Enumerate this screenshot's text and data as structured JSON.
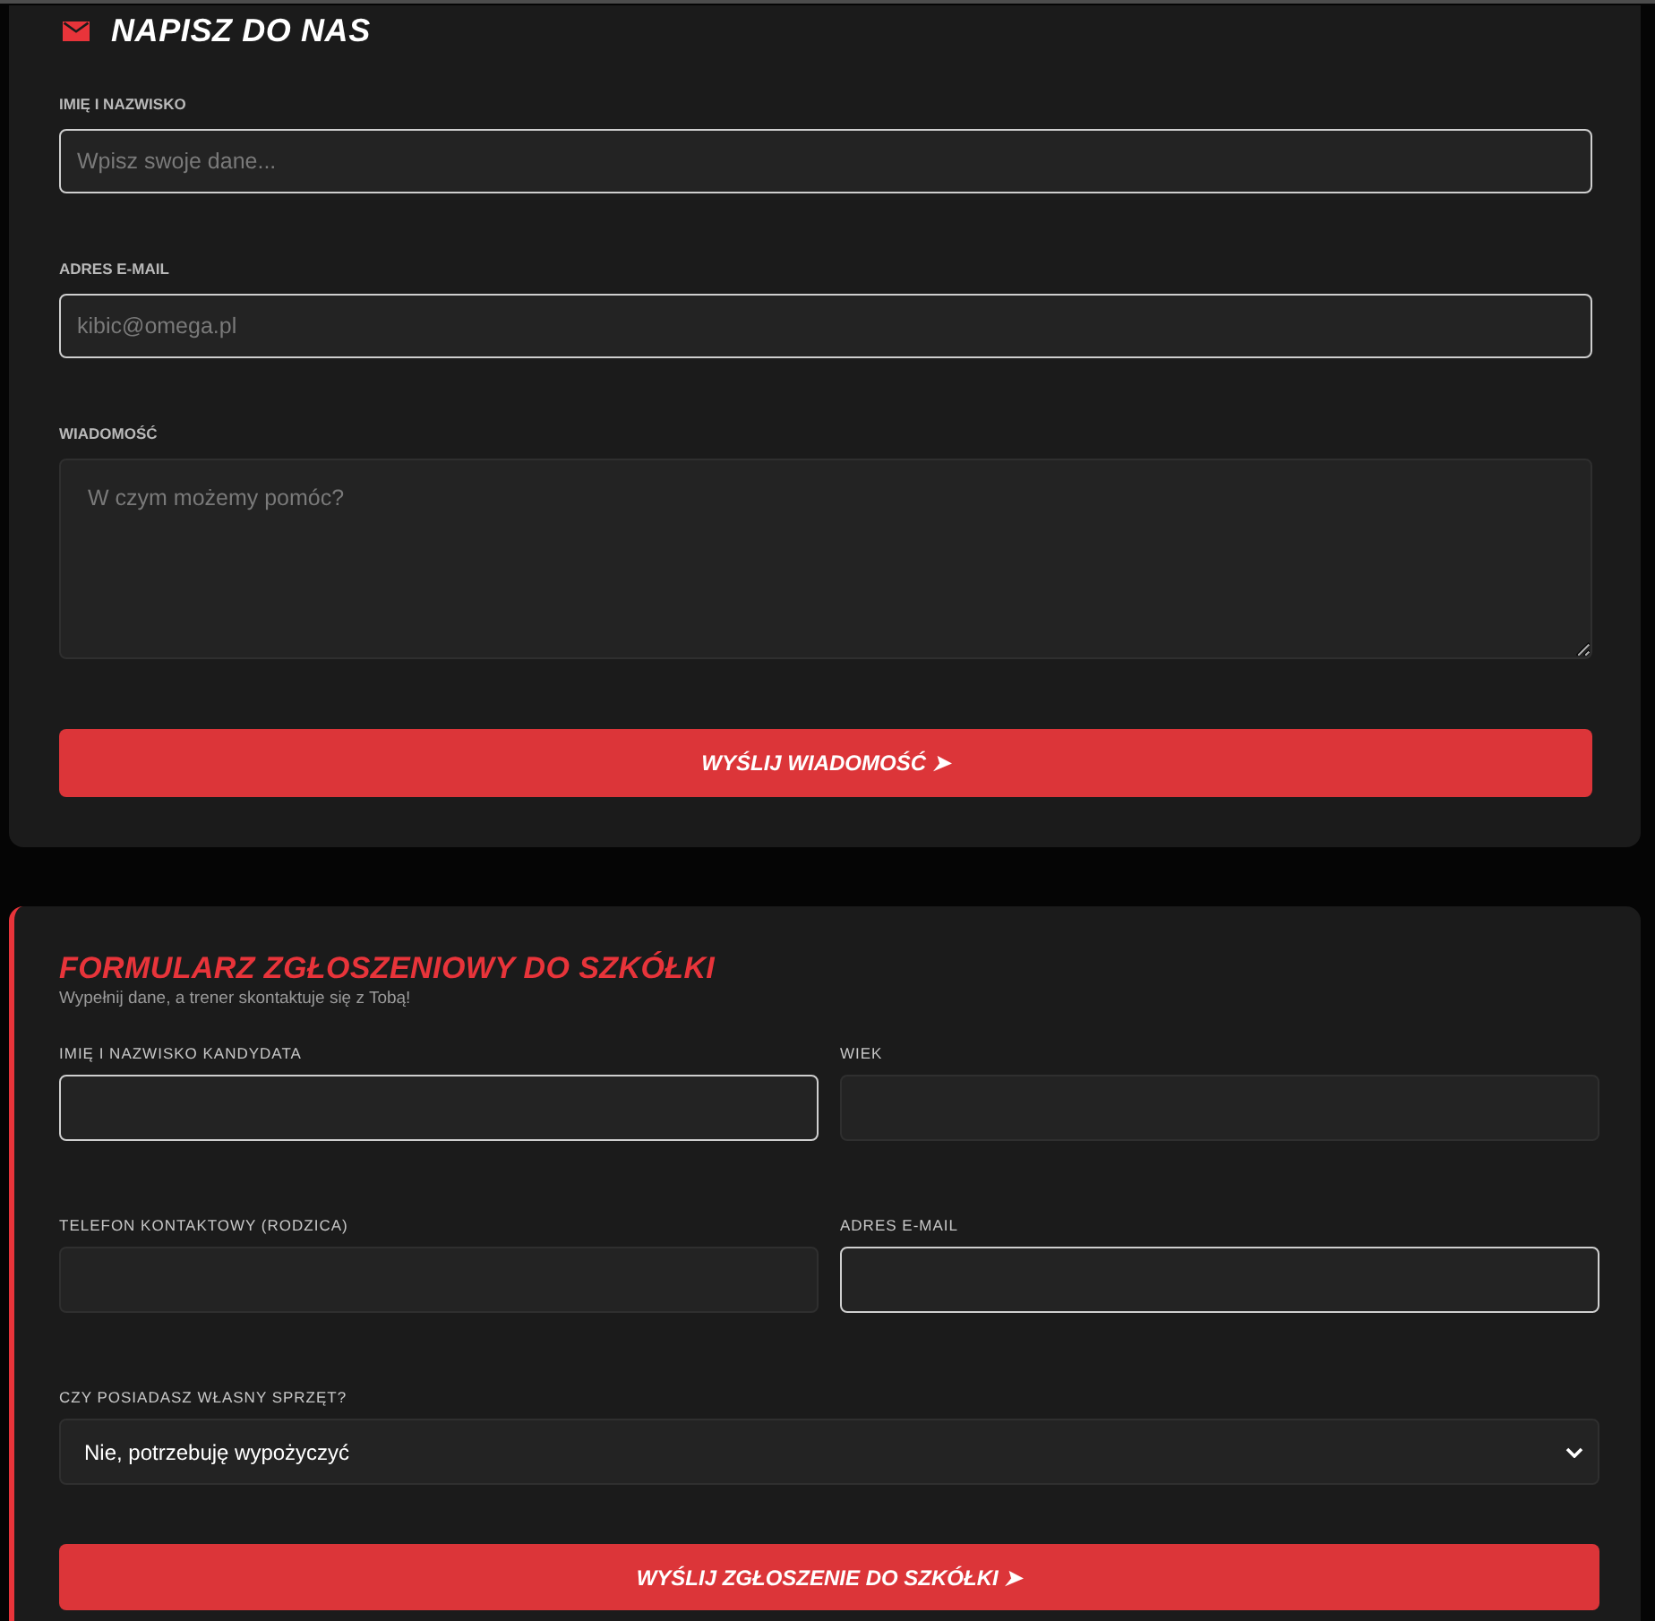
{
  "contact_form": {
    "title": "NAPISZ DO NAS",
    "fields": [
      {
        "label": "IMIĘ I NAZWISKO",
        "kind": "text",
        "placeholder": "Wpisz swoje dane..."
      },
      {
        "label": "ADRES E-MAIL",
        "kind": "email",
        "placeholder": "kibic@omega.pl"
      },
      {
        "label": "WIADOMOŚĆ",
        "kind": "textarea",
        "placeholder": "W czym możemy pomóc?"
      }
    ],
    "submit": "WYŚLIJ WIADOMOŚĆ ➤"
  },
  "school_form": {
    "title": "FORMULARZ ZGŁOSZENIOWY DO SZKÓŁKI",
    "subtitle": "Wypełnij dane, a trener skontaktuje się z Tobą!",
    "fields": [
      {
        "label": "IMIĘ I NAZWISKO KANDYDATA",
        "kind": "text"
      },
      {
        "label": "WIEK",
        "kind": "number"
      },
      {
        "label": "TELEFON KONTAKTOWY (RODZICA)",
        "kind": "tel"
      },
      {
        "label": "ADRES E-MAIL",
        "kind": "email"
      },
      {
        "label": "CZY POSIADASZ WŁASNY SPRZĘT?",
        "kind": "select",
        "value": "Nie, potrzebuję wypożyczyć"
      }
    ],
    "submit": "WYŚLIJ ZGŁOSZENIE DO SZKÓŁKI ➤"
  }
}
